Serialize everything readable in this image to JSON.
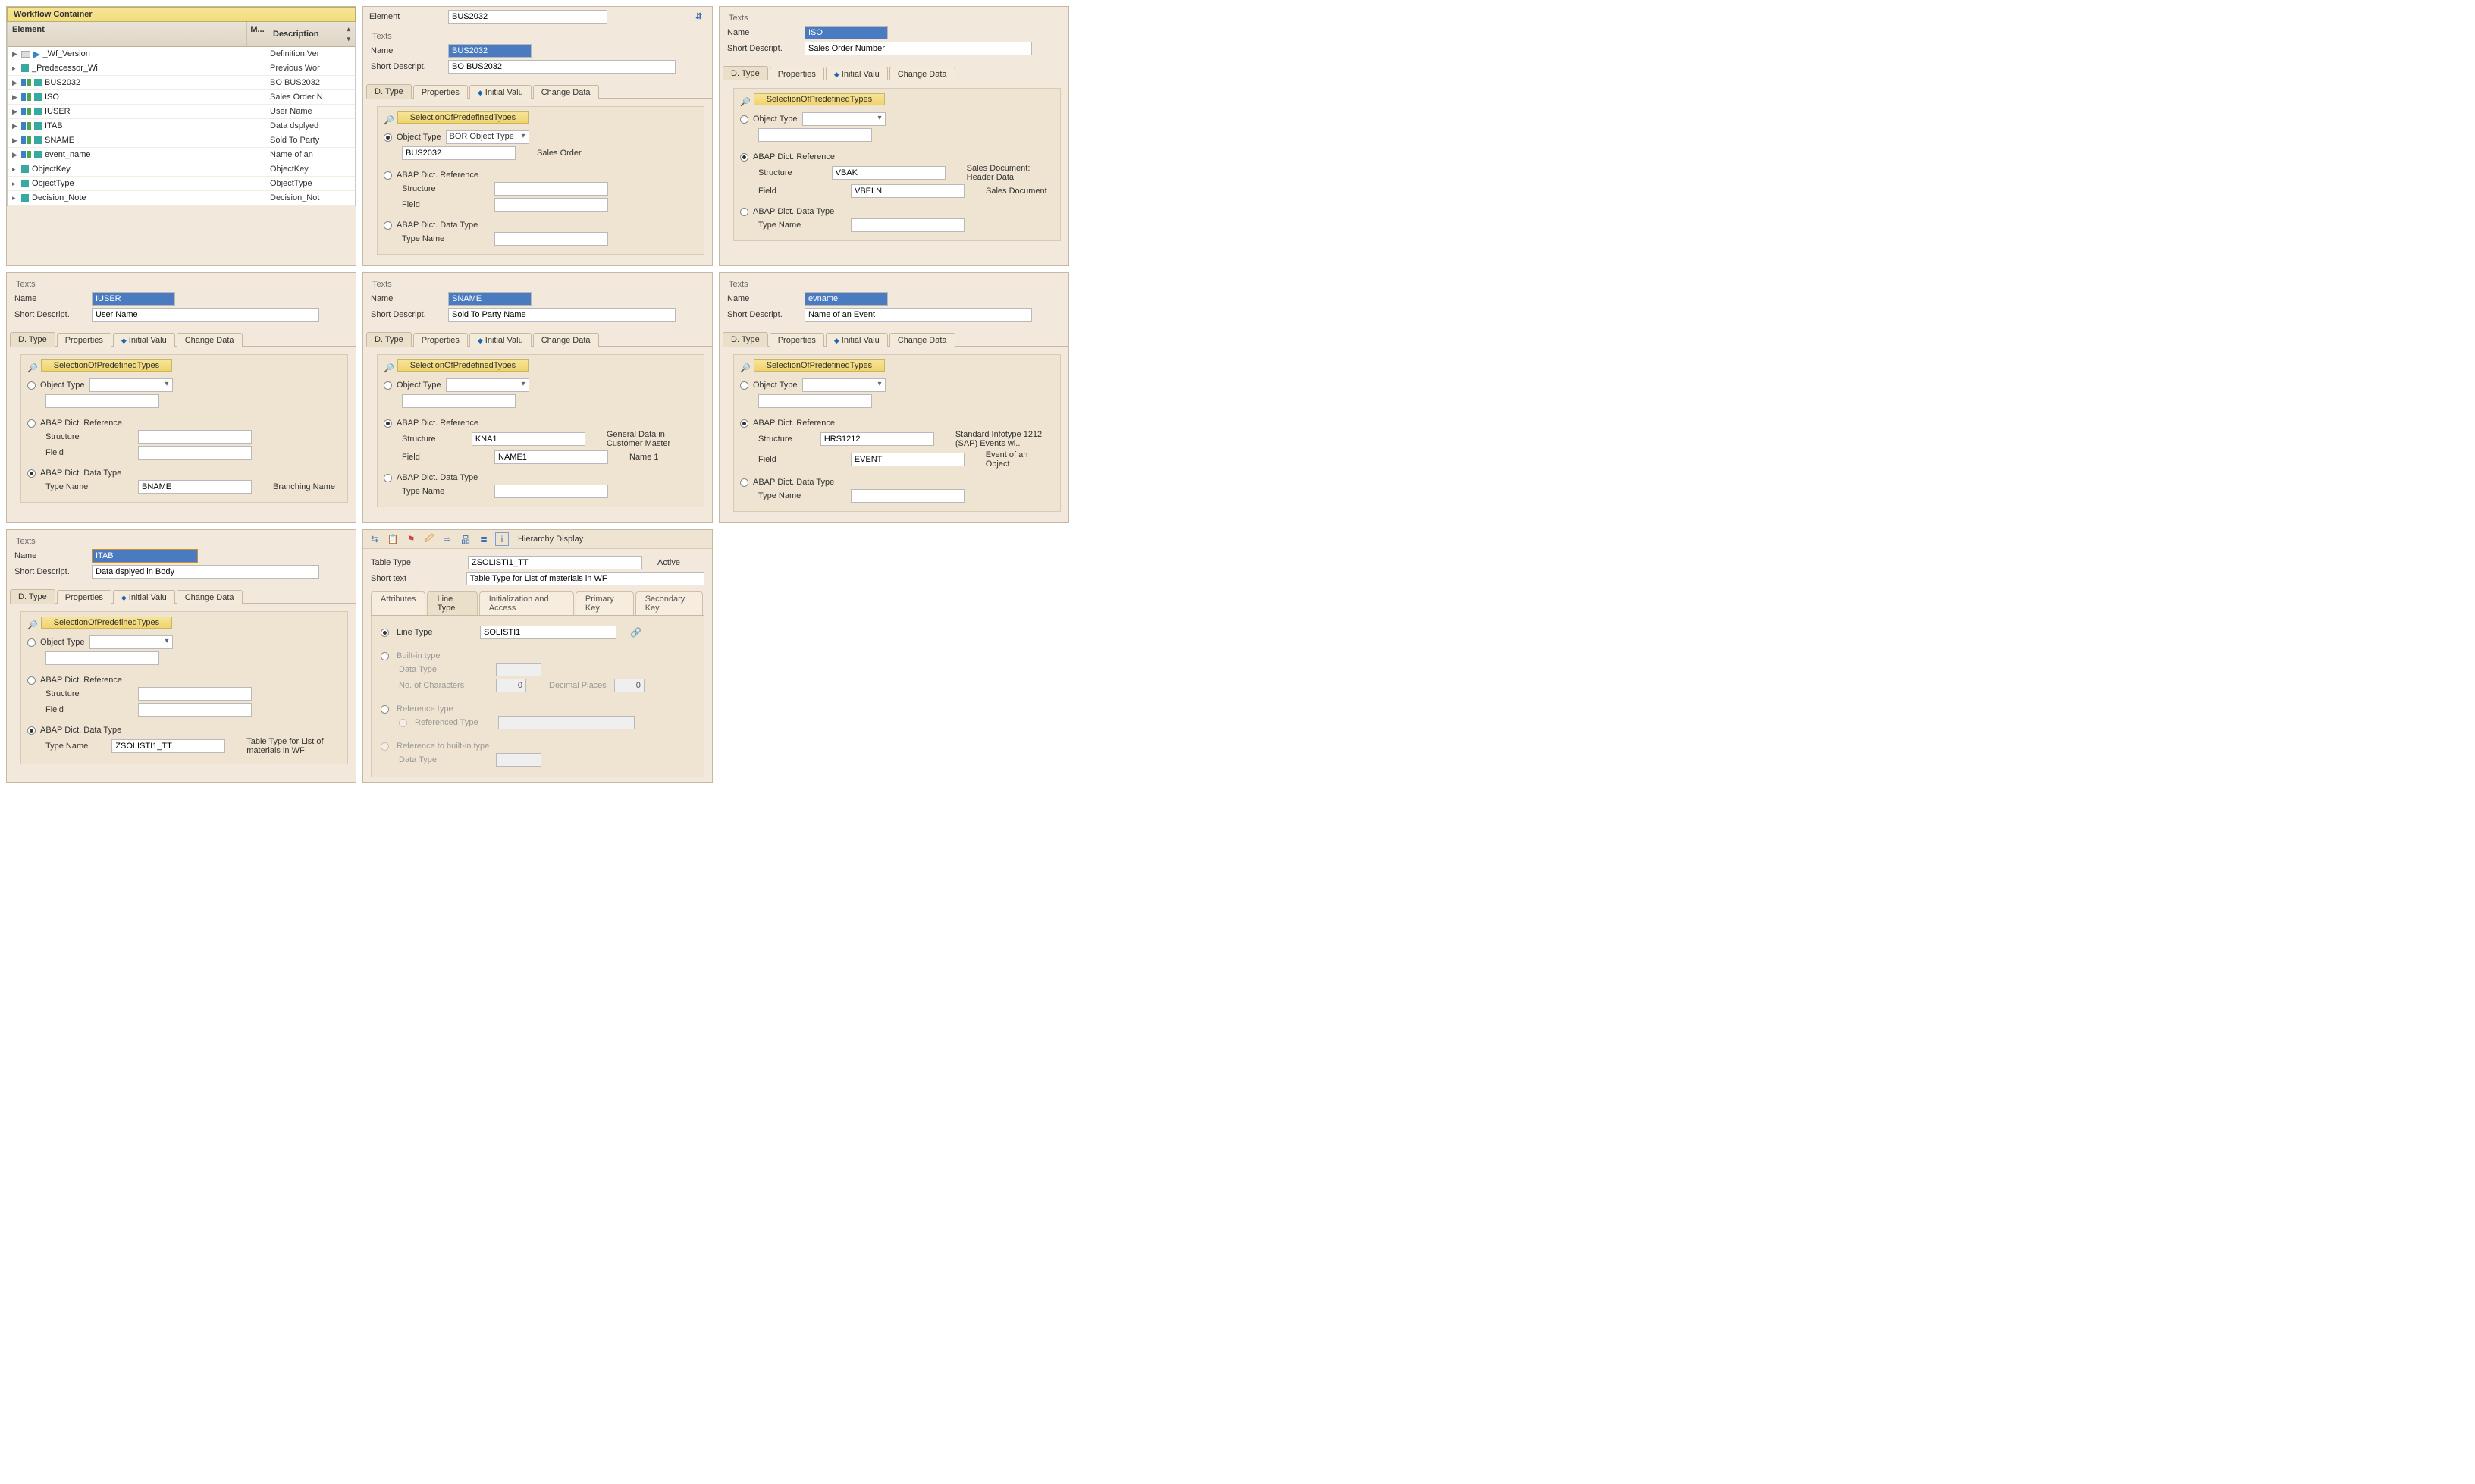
{
  "wf": {
    "title": "Workflow Container",
    "cols": {
      "c1": "Element",
      "c2": "M...",
      "c3": "Description"
    },
    "rows": [
      {
        "icon": "ver",
        "name": "_Wf_Version",
        "desc": "Definition Ver"
      },
      {
        "icon": "box",
        "name": "_Predecessor_Wi",
        "desc": "Previous Wor"
      },
      {
        "icon": "imp",
        "name": "BUS2032",
        "desc": "BO BUS2032"
      },
      {
        "icon": "imp",
        "name": "ISO",
        "desc": "Sales Order N"
      },
      {
        "icon": "imp",
        "name": "IUSER",
        "desc": "User Name"
      },
      {
        "icon": "imp",
        "name": "ITAB",
        "desc": "Data dsplyed"
      },
      {
        "icon": "imp",
        "name": "SNAME",
        "desc": "Sold To Party"
      },
      {
        "icon": "imp",
        "name": "event_name",
        "desc": "Name of an"
      },
      {
        "icon": "box",
        "name": "ObjectKey",
        "desc": "ObjectKey"
      },
      {
        "icon": "box",
        "name": "ObjectType",
        "desc": "ObjectType"
      },
      {
        "icon": "box",
        "name": "Decision_Note",
        "desc": "Decision_Not"
      }
    ]
  },
  "tabs": {
    "t1": "D. Type",
    "t2": "Properties",
    "t3": "Initial Valu",
    "t4": "Change Data"
  },
  "group_hdr": "SelectionOfPredefinedTypes",
  "labels": {
    "texts": "Texts",
    "name": "Name",
    "short": "Short Descript.",
    "element": "Element",
    "objtype": "Object Type",
    "abapref": "ABAP Dict. Reference",
    "abaptype": "ABAP Dict. Data Type",
    "structure": "Structure",
    "field": "Field",
    "typename": "Type Name",
    "dd_bor": "BOR Object Type"
  },
  "bus2032": {
    "elem": "BUS2032",
    "name": "BUS2032",
    "short": "BO BUS2032",
    "bor": "BUS2032",
    "bor_desc": "Sales Order"
  },
  "iso": {
    "name": "ISO",
    "short": "Sales Order Number",
    "struct": "VBAK",
    "struct_d": "Sales Document: Header Data",
    "field": "VBELN",
    "field_d": "Sales Document"
  },
  "iuser": {
    "name": "IUSER",
    "short": "User Name",
    "typename": "BNAME",
    "typename_d": "Branching Name"
  },
  "sname": {
    "name": "SNAME",
    "short": "Sold To Party Name",
    "struct": "KNA1",
    "struct_d": "General Data in Customer Master",
    "field": "NAME1",
    "field_d": "Name 1"
  },
  "evname": {
    "name": "evname",
    "short": "Name of an Event",
    "struct": "HRS1212",
    "struct_d": "Standard Infotype 1212 (SAP) Events wi..",
    "field": "EVENT",
    "field_d": "Event of an Object"
  },
  "itab": {
    "name": "ITAB",
    "short": "Data dsplyed in Body",
    "typename": "ZSOLISTI1_TT",
    "typename_d": "Table Type for List of materials in WF"
  },
  "tt": {
    "toolbar_label": "Hierarchy Display",
    "tabs": {
      "a": "Attributes",
      "b": "Line Type",
      "c": "Initialization and Access",
      "d": "Primary Key",
      "e": "Secondary Key"
    },
    "tabletype": "Table Type",
    "tabletype_v": "ZSOLISTI1_TT",
    "status": "Active",
    "shorttext": "Short text",
    "shorttext_v": "Table Type for List of materials in WF",
    "linetype": "Line Type",
    "linetype_v": "SOLISTI1",
    "builtin": "Built-in type",
    "datatype": "Data Type",
    "nochars": "No. of Characters",
    "nochars_v": "0",
    "decplaces": "Decimal Places",
    "decplaces_v": "0",
    "reftype": "Reference type",
    "refd": "Referenced Type",
    "refbuilt": "Reference to built-in type"
  }
}
